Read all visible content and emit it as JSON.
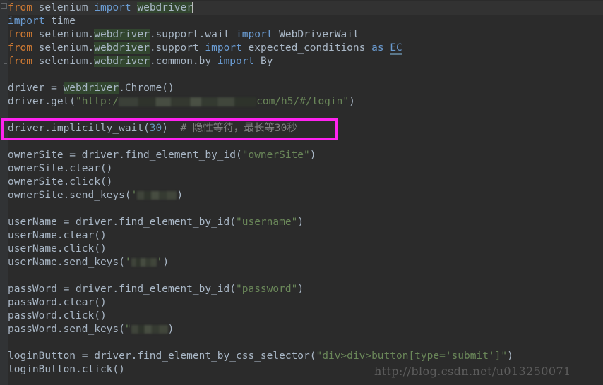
{
  "editor": {
    "background_color": "#2b2b2b",
    "gutter_color": "#313335",
    "caret_line_color": "#323232",
    "default_text_color": "#a9b7c6",
    "keyword_color": "#cc7832",
    "import_keyword_color": "#6a9bd1",
    "string_color": "#6a8759",
    "number_color": "#6897bb",
    "comment_color": "#808080",
    "occurrence_highlight_color": "#32462f",
    "annotation_box_color": "#ff24f0",
    "language": "Python"
  },
  "code": {
    "lines": [
      {
        "n": 1,
        "text": "from selenium import webdriver",
        "tokens": [
          {
            "t": "from",
            "k": "kw"
          },
          {
            "t": " selenium ",
            "k": "plain"
          },
          {
            "t": "import",
            "k": "imp"
          },
          {
            "t": " ",
            "k": "plain"
          },
          {
            "t": "webdriver",
            "k": "occ"
          }
        ]
      },
      {
        "n": 2,
        "text": "import time",
        "tokens": [
          {
            "t": "import",
            "k": "imp"
          },
          {
            "t": " time",
            "k": "plain"
          }
        ]
      },
      {
        "n": 3,
        "text": "from selenium.webdriver.support.wait import WebDriverWait",
        "tokens": [
          {
            "t": "from",
            "k": "kw"
          },
          {
            "t": " selenium.",
            "k": "plain"
          },
          {
            "t": "webdriver",
            "k": "occ"
          },
          {
            "t": ".support.wait ",
            "k": "plain"
          },
          {
            "t": "import",
            "k": "imp"
          },
          {
            "t": " WebDriverWait",
            "k": "plain"
          }
        ]
      },
      {
        "n": 4,
        "text": "from selenium.webdriver.support import expected_conditions as EC",
        "tokens": [
          {
            "t": "from",
            "k": "kw"
          },
          {
            "t": " selenium.",
            "k": "plain"
          },
          {
            "t": "webdriver",
            "k": "occ"
          },
          {
            "t": ".support ",
            "k": "plain"
          },
          {
            "t": "import",
            "k": "imp"
          },
          {
            "t": " expected_conditions ",
            "k": "plain"
          },
          {
            "t": "as",
            "k": "imp"
          },
          {
            "t": " ",
            "k": "plain"
          },
          {
            "t": "EC",
            "k": "squig"
          }
        ]
      },
      {
        "n": 5,
        "text": "from selenium.webdriver.common.by import By",
        "tokens": [
          {
            "t": "from",
            "k": "kw"
          },
          {
            "t": " selenium.",
            "k": "plain"
          },
          {
            "t": "webdriver",
            "k": "occ"
          },
          {
            "t": ".common.by ",
            "k": "plain"
          },
          {
            "t": "import",
            "k": "imp"
          },
          {
            "t": " By",
            "k": "plain"
          }
        ]
      },
      {
        "n": 6,
        "text": "",
        "tokens": []
      },
      {
        "n": 7,
        "text": "driver = webdriver.Chrome()",
        "tokens": [
          {
            "t": "driver = ",
            "k": "plain"
          },
          {
            "t": "webdriver",
            "k": "occ"
          },
          {
            "t": ".Chrome()",
            "k": "plain"
          }
        ]
      },
      {
        "n": 8,
        "text": "driver.get(\"http://[REDACTED].com/h5/#/login\")",
        "tokens": [
          {
            "t": "driver.get(",
            "k": "plain"
          },
          {
            "t": "\"http:/",
            "k": "str"
          },
          {
            "t": "[redacted-url]",
            "k": "redact-url"
          },
          {
            "t": "com/h5/#/login\"",
            "k": "str"
          },
          {
            "t": ")",
            "k": "plain"
          }
        ]
      },
      {
        "n": 9,
        "text": "",
        "tokens": []
      },
      {
        "n": 10,
        "text": "driver.implicitly_wait(30)  # 隐性等待，最长等30秒",
        "highlighted": true,
        "tokens": [
          {
            "t": "driver.implicitly_wait(",
            "k": "plain"
          },
          {
            "t": "30",
            "k": "num"
          },
          {
            "t": ")  ",
            "k": "plain"
          },
          {
            "t": "# 隐性等待，最长等30秒",
            "k": "cmt"
          }
        ]
      },
      {
        "n": 11,
        "text": "",
        "tokens": []
      },
      {
        "n": 12,
        "text": "ownerSite = driver.find_element_by_id(\"ownerSite\")",
        "tokens": [
          {
            "t": "ownerSite = driver.find_element_by_id(",
            "k": "plain"
          },
          {
            "t": "\"ownerSite\"",
            "k": "str"
          },
          {
            "t": ")",
            "k": "plain"
          }
        ]
      },
      {
        "n": 13,
        "text": "ownerSite.clear()",
        "tokens": [
          {
            "t": "ownerSite.clear()",
            "k": "plain"
          }
        ]
      },
      {
        "n": 14,
        "text": "ownerSite.click()",
        "tokens": [
          {
            "t": "ownerSite.click()",
            "k": "plain"
          }
        ]
      },
      {
        "n": 15,
        "text": "ownerSite.send_keys('[REDACTED]')",
        "tokens": [
          {
            "t": "ownerSite.send_keys(",
            "k": "plain"
          },
          {
            "t": "'",
            "k": "str"
          },
          {
            "t": "[redacted-value]",
            "k": "redact-sm"
          },
          {
            "t": ")",
            "k": "plain"
          }
        ]
      },
      {
        "n": 16,
        "text": "",
        "tokens": []
      },
      {
        "n": 17,
        "text": "userName = driver.find_element_by_id(\"username\")",
        "tokens": [
          {
            "t": "userName = driver.find_element_by_id(",
            "k": "plain"
          },
          {
            "t": "\"username\"",
            "k": "str"
          },
          {
            "t": ")",
            "k": "plain"
          }
        ]
      },
      {
        "n": 18,
        "text": "userName.clear()",
        "tokens": [
          {
            "t": "userName.clear()",
            "k": "plain"
          }
        ]
      },
      {
        "n": 19,
        "text": "userName.click()",
        "tokens": [
          {
            "t": "userName.click()",
            "k": "plain"
          }
        ]
      },
      {
        "n": 20,
        "text": "userName.send_keys('[REDACTED]')",
        "tokens": [
          {
            "t": "userName.send_keys(",
            "k": "plain"
          },
          {
            "t": "'",
            "k": "str"
          },
          {
            "t": "[redacted-value]",
            "k": "redact-sm"
          },
          {
            "t": "')",
            "k": "plain"
          }
        ]
      },
      {
        "n": 21,
        "text": "",
        "tokens": []
      },
      {
        "n": 22,
        "text": "passWord = driver.find_element_by_id(\"password\")",
        "tokens": [
          {
            "t": "passWord = driver.find_element_by_id(",
            "k": "plain"
          },
          {
            "t": "\"password\"",
            "k": "str"
          },
          {
            "t": ")",
            "k": "plain"
          }
        ]
      },
      {
        "n": 23,
        "text": "passWord.clear()",
        "tokens": [
          {
            "t": "passWord.clear()",
            "k": "plain"
          }
        ]
      },
      {
        "n": 24,
        "text": "passWord.click()",
        "tokens": [
          {
            "t": "passWord.click()",
            "k": "plain"
          }
        ]
      },
      {
        "n": 25,
        "text": "passWord.send_keys(\"[REDACTED]\")",
        "tokens": [
          {
            "t": "passWord.send_keys(",
            "k": "plain"
          },
          {
            "t": "\"",
            "k": "str"
          },
          {
            "t": "[redacted-value]",
            "k": "redact-sm"
          },
          {
            "t": ")",
            "k": "plain"
          }
        ]
      },
      {
        "n": 26,
        "text": "",
        "tokens": []
      },
      {
        "n": 27,
        "text": "loginButton = driver.find_element_by_css_selector(\"div>div>button[type='submit']\")",
        "tokens": [
          {
            "t": "loginButton = driver.find_element_by_css_selector(",
            "k": "plain"
          },
          {
            "t": "\"div>div>button[type=",
            "k": "str"
          },
          {
            "t": "'submit'",
            "k": "str2"
          },
          {
            "t": "]\"",
            "k": "str"
          },
          {
            "t": ")",
            "k": "plain"
          }
        ]
      },
      {
        "n": 28,
        "text": "loginButton.click()",
        "tokens": [
          {
            "t": "loginButton.click()",
            "k": "plain"
          }
        ]
      }
    ]
  },
  "annotation": {
    "name": "magenta-highlight-box",
    "target_line": 10,
    "target_text": "driver.implicitly_wait(30)  # 隐性等待，最长等30秒",
    "color": "#ff24f0"
  },
  "caret": {
    "line": 1,
    "after_text": "webdriver"
  },
  "watermark": {
    "text": "http://blog.csdn.net/u013250071"
  }
}
